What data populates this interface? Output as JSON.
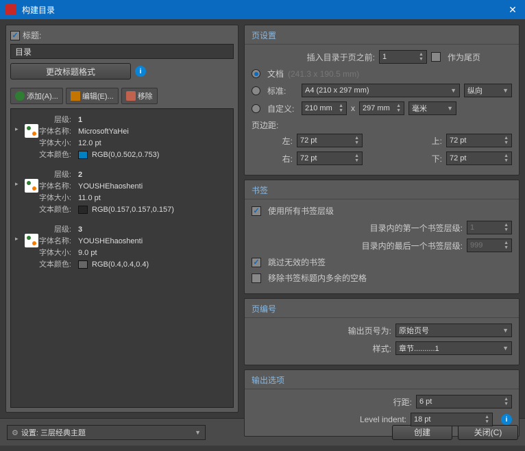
{
  "window": {
    "title": "构建目录"
  },
  "left": {
    "title_checkbox_label": "标题:",
    "title_value": "目录",
    "change_format": "更改标题格式",
    "toolbar": {
      "add": "添加(A)...",
      "edit": "编辑(E)...",
      "remove": "移除"
    },
    "labels": {
      "level": "层级:",
      "font_name": "字体名称:",
      "font_size": "字体大小:",
      "text_color": "文本颜色:"
    },
    "levels": [
      {
        "level": "1",
        "font_name": "MicrosoftYaHei",
        "font_size": "12.0 pt",
        "text_color": "RGB(0,0.502,0.753)",
        "swatch": "#0080c0"
      },
      {
        "level": "2",
        "font_name": "YOUSHEhaoshenti",
        "font_size": "11.0 pt",
        "text_color": "RGB(0.157,0.157,0.157)",
        "swatch": "#282828"
      },
      {
        "level": "3",
        "font_name": "YOUSHEhaoshenti",
        "font_size": "9.0 pt",
        "text_color": "RGB(0.4,0.4,0.4)",
        "swatch": "#666666"
      }
    ]
  },
  "page_settings": {
    "title": "页设置",
    "insert_before_label": "插入目录于页之前:",
    "insert_before_value": "1",
    "as_last_page": "作为尾页",
    "doc_radio": "文档",
    "doc_dims": "(241.3 x 190.5 mm)",
    "standard_radio": "标准:",
    "standard_value": "A4 (210 x 297 mm)",
    "orientation": "纵向",
    "custom_radio": "自定义:",
    "custom_w": "210 mm",
    "x": "x",
    "custom_h": "297 mm",
    "unit": "毫米",
    "margins_label": "页边距:",
    "left_l": "左:",
    "left_v": "72 pt",
    "top_l": "上:",
    "top_v": "72 pt",
    "right_l": "右:",
    "right_v": "72 pt",
    "bottom_l": "下:",
    "bottom_v": "72 pt"
  },
  "bookmarks": {
    "title": "书签",
    "use_all": "使用所有书签层级",
    "first_label": "目录内的第一个书签层级:",
    "first_value": "1",
    "last_label": "目录内的最后一个书签层级:",
    "last_value": "999",
    "skip_invalid": "跳过无效的书签",
    "strip_spaces": "移除书签标题内多余的空格"
  },
  "page_num": {
    "title": "页编号",
    "output_as_label": "输出页号为:",
    "output_as_value": "原始页号",
    "style_label": "样式:",
    "style_value": "章节..........1"
  },
  "output": {
    "title": "输出选项",
    "line_spacing_label": "行距:",
    "line_spacing_value": "6 pt",
    "indent_label": "Level indent:",
    "indent_value": "18 pt"
  },
  "footer": {
    "settings_label": "设置:",
    "theme": "三层经典主题",
    "create": "创建",
    "close": "关闭(C)"
  }
}
